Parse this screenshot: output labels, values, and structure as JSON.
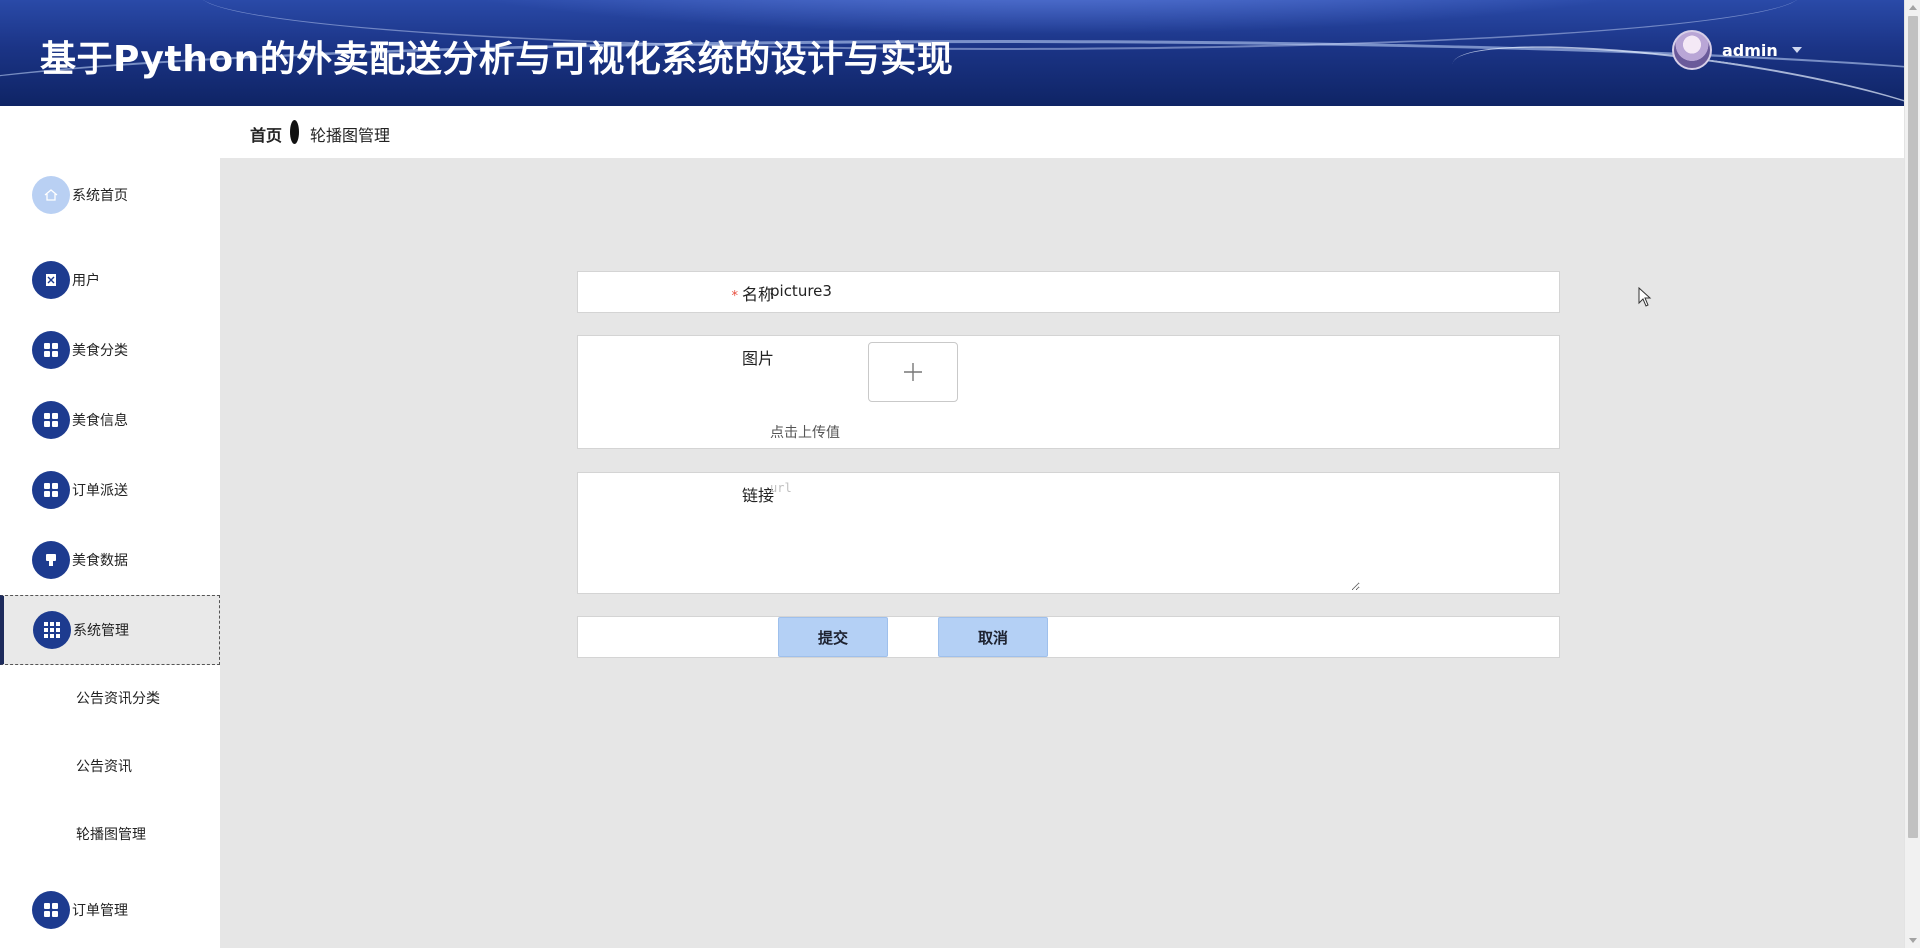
{
  "header": {
    "title": "基于Python的外卖配送分析与可视化系统的设计与实现",
    "user": "admin"
  },
  "breadcrumb": {
    "home": "首页",
    "current": "轮播图管理"
  },
  "sidebar": {
    "items": [
      {
        "label": "系统首页",
        "icon": "home-icon"
      },
      {
        "label": "用户",
        "icon": "user-icon"
      },
      {
        "label": "美食分类",
        "icon": "grid-icon"
      },
      {
        "label": "美食信息",
        "icon": "grid-icon"
      },
      {
        "label": "订单派送",
        "icon": "grid-icon"
      },
      {
        "label": "美食数据",
        "icon": "stamp-icon"
      },
      {
        "label": "系统管理",
        "icon": "grid-icon"
      },
      {
        "label": "订单管理",
        "icon": "grid-icon"
      }
    ],
    "sub_items": [
      "公告资讯分类",
      "公告资讯",
      "轮播图管理"
    ]
  },
  "form": {
    "name_label": "名称",
    "name_value": "picture3",
    "image_label": "图片",
    "upload_hint": "点击上传值",
    "link_label": "链接",
    "link_placeholder": "url",
    "submit": "提交",
    "cancel": "取消"
  },
  "colors": {
    "header_dark": "#0f2465",
    "menu_icon": "#1d3b8f",
    "button": "#b4d0f5",
    "required": "#e74c3c"
  }
}
